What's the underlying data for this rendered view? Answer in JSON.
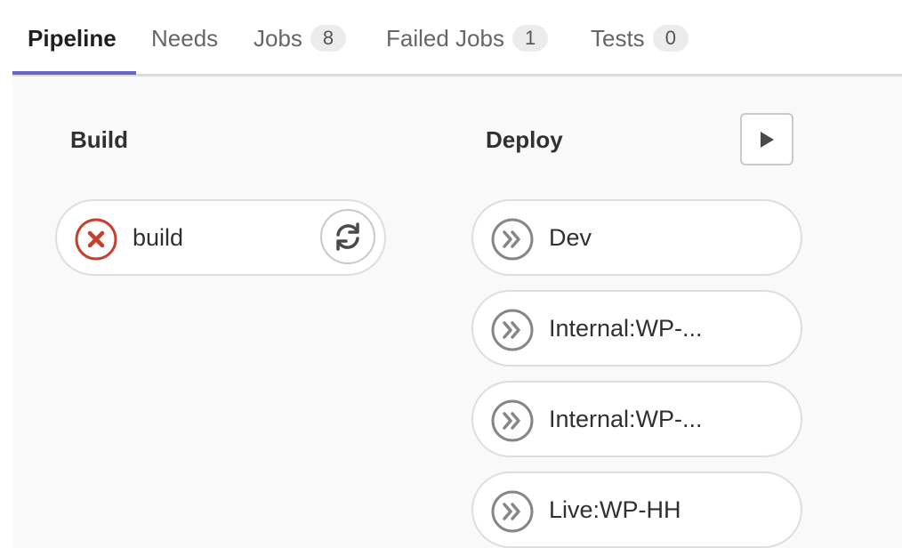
{
  "tabs": [
    {
      "label": "Pipeline",
      "badge": null,
      "active": true
    },
    {
      "label": "Needs",
      "badge": null,
      "active": false
    },
    {
      "label": "Jobs",
      "badge": "8",
      "active": false
    },
    {
      "label": "Failed Jobs",
      "badge": "1",
      "active": false
    },
    {
      "label": "Tests",
      "badge": "0",
      "active": false
    }
  ],
  "stages": [
    {
      "title": "Build",
      "jobs": [
        {
          "name": "build",
          "status": "failed",
          "status_icon": "failed-x-icon",
          "action_icon": "retry-icon"
        }
      ]
    },
    {
      "title": "Deploy",
      "action_icon": "play-icon",
      "jobs": [
        {
          "name": "Dev",
          "status": "skipped",
          "status_icon": "skipped-chevrons-icon"
        },
        {
          "name": "Internal:WP-...",
          "status": "skipped",
          "status_icon": "skipped-chevrons-icon"
        },
        {
          "name": "Internal:WP-...",
          "status": "skipped",
          "status_icon": "skipped-chevrons-icon"
        },
        {
          "name": "Live:WP-HH",
          "status": "skipped",
          "status_icon": "skipped-chevrons-icon"
        }
      ]
    }
  ],
  "colors": {
    "failed": "#c7402d",
    "skipped": "#868686",
    "active_tab_underline": "#6666c4"
  }
}
